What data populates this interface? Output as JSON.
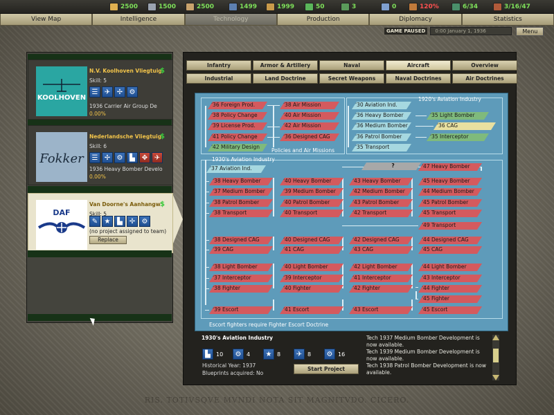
{
  "topbar": {
    "resources": [
      {
        "icon": "energy-icon",
        "value": "2500",
        "color": "#e0b050"
      },
      {
        "icon": "metal-icon",
        "value": "1500",
        "color": "#9aa3b0"
      },
      {
        "icon": "rare-materials-icon",
        "value": "2500",
        "color": "#c9a36c"
      },
      {
        "icon": "oil-icon",
        "value": "1499",
        "color": "#5d7fb0"
      },
      {
        "icon": "supplies-icon",
        "value": "1999",
        "color": "#c99a4a"
      },
      {
        "icon": "money-icon",
        "value": "50",
        "color": "#5ab55a"
      },
      {
        "icon": "manpower-icon",
        "value": "3",
        "color": "#5a9a5a"
      },
      {
        "icon": "transports-icon",
        "value": "0",
        "color": "#7fa0d0"
      },
      {
        "icon": "dissent-icon",
        "value": "120%",
        "color": "#c07a3a",
        "alert": true
      },
      {
        "icon": "escorts-icon",
        "value": "6/34",
        "color": "#4a8f6a"
      },
      {
        "icon": "ic-icon",
        "value": "3/16/47",
        "color": "#b05a3a"
      }
    ]
  },
  "nav": {
    "items": [
      "View Map",
      "Intelligence",
      "Technology",
      "Production",
      "Diplomacy",
      "Statistics"
    ]
  },
  "status": {
    "paused": "GAME PAUSED",
    "date": "0:00 January 1, 1936",
    "menu": "Menu"
  },
  "teams": [
    {
      "name": "N.V. Koolhoven Vliegtuig",
      "logo_text": "KOOLHOVEN",
      "skill": "Skill: 5",
      "project": "1936 Carrier Air Group De",
      "progress": "0.00%"
    },
    {
      "name": "Nederlandsche Vliegtuig",
      "logo_text": "Fokker",
      "skill": "Skill: 6",
      "project": "1936 Heavy Bomber Develo",
      "progress": "0.00%"
    },
    {
      "name": "Van Doorne's Aanhangw",
      "logo_text": "DAF",
      "skill": "Skill: 5",
      "project": "(no project assigned to team)",
      "replace": "Replace"
    }
  ],
  "tabs": {
    "row1": [
      "Infantry",
      "Armor & Artillery",
      "Naval",
      "Aircraft",
      "Overview"
    ],
    "row2": [
      "Industrial",
      "Land Doctrine",
      "Secret Weapons",
      "Naval Doctrines",
      "Air Doctrines"
    ]
  },
  "tree": {
    "policies_label": "Policies and Air Missions",
    "aviation1920_label": "1920's Aviation Industry",
    "aviation1930_label": "1930's Aviation Industry",
    "escort_note": "Escort fighters require Fighter Escort Doctrine",
    "unknown": "?",
    "policies": [
      "'36 Foreign Prod.",
      "'38 Policy Change",
      "'39 License Prod.",
      "'41 Policy Change",
      "'42 Military Design"
    ],
    "missions": [
      "'38 Air Mission",
      "'40 Air Mission",
      "'42 Air Mission",
      "'36 Designed CAG"
    ],
    "aviation1920": [
      "'30 Aviation Ind.",
      "'36 Heavy Bomber",
      "'36 Medium Bomber",
      "'36 Patrol Bomber",
      "'35 Transport"
    ],
    "aviation1920_right": [
      "'35 Light Bomber",
      "'36 CAG",
      "'35 Interceptor"
    ],
    "aviation1930": "'37 Aviation Ind.",
    "grid_cols": [
      [
        "'38 Heavy Bomber",
        "'37 Medium Bomber",
        "'38 Patrol Bomber",
        "'38 Transport",
        "'38 Designed CAG",
        "'39 CAG",
        "'38 Light Bomber",
        "'37 Interceptor",
        "'38 Fighter",
        "'39 Escort"
      ],
      [
        "'40 Heavy Bomber",
        "'39 Medium Bomber",
        "'40 Patrol Bomber",
        "'40 Transport",
        "'40 Designed CAG",
        "'41 CAG",
        "'40 Light Bomber",
        "'39 Interceptor",
        "'40 Fighter",
        "'41 Escort"
      ],
      [
        "'43 Heavy Bomber",
        "'42 Medium Bomber",
        "'43 Patrol Bomber",
        "'42 Transport",
        "'42 Designed CAG",
        "'43 CAG",
        "'42 Light Bomber",
        "'41 Interceptor",
        "'42 Fighter",
        "'43 Escort"
      ],
      [
        "'45 Heavy Bomber",
        "'44 Medium Bomber",
        "'45 Patrol Bomber",
        "'45 Transport",
        "'44 Designed CAG",
        "'45 CAG",
        "'44 Light Bomber",
        "'43 Interceptor",
        "'44 Fighter",
        "'45 Escort"
      ]
    ],
    "extra": [
      "'47 Heavy Bomber",
      "'49 Transport",
      "'45 Fighter"
    ]
  },
  "details": {
    "title": "1930's Aviation Industry",
    "stats": [
      {
        "icon": "factory-icon",
        "value": "10"
      },
      {
        "icon": "gear-icon",
        "value": "4"
      },
      {
        "icon": "star-icon",
        "value": "8"
      },
      {
        "icon": "plane-icon",
        "value": "8"
      },
      {
        "icon": "cog-icon",
        "value": "16"
      }
    ],
    "year": "Historical Year: 1937",
    "blueprints": "Blueprints acquired: No",
    "start": "Start Project"
  },
  "messages": [
    "Tech 1937 Medium Bomber Development is now available.",
    "Tech 1939 Medium Bomber Development is now available.",
    "Tech 1938 Patrol Bomber Development is now available."
  ],
  "motto": "RIS. TOTIVSQVE MVNDI NOTA SIT MAGNITVDO. CICERO."
}
